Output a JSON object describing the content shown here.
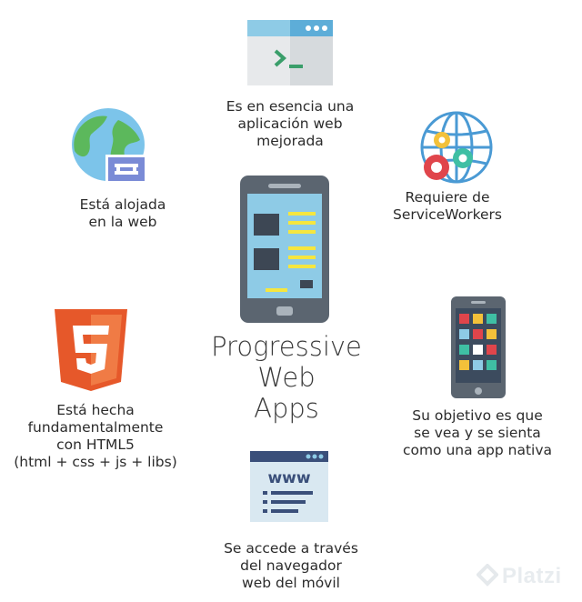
{
  "title": "Progressive\nWeb\nApps",
  "items": {
    "top": "Es en esencia una\naplicación web\nmejorada",
    "top_left": "Está alojada\nen la web",
    "top_right": "Requiere de\nServiceWorkers",
    "mid_left": "Está hecha\nfundamentalmente\ncon HTML5\n(html + css + js + libs)",
    "mid_right": "Su objetivo es que\nse vea y se sienta\ncomo una app nativa",
    "bottom": "Se accede a través\ndel navegador\nweb del móvil"
  },
  "icons": {
    "top": "terminal-window-icon",
    "top_left": "globe-link-icon",
    "top_right": "globe-gears-icon",
    "center": "tablet-webpage-icon",
    "mid_left": "html5-logo-icon",
    "mid_right": "smartphone-apps-icon",
    "bottom": "browser-www-icon"
  },
  "brand": "Platzi",
  "colors": {
    "text": "#2b2b2b",
    "html5_orange": "#e6582a",
    "device_gray": "#5b6570",
    "screen_blue": "#8ecbe6",
    "highlight_yellow": "#f5e63f"
  }
}
